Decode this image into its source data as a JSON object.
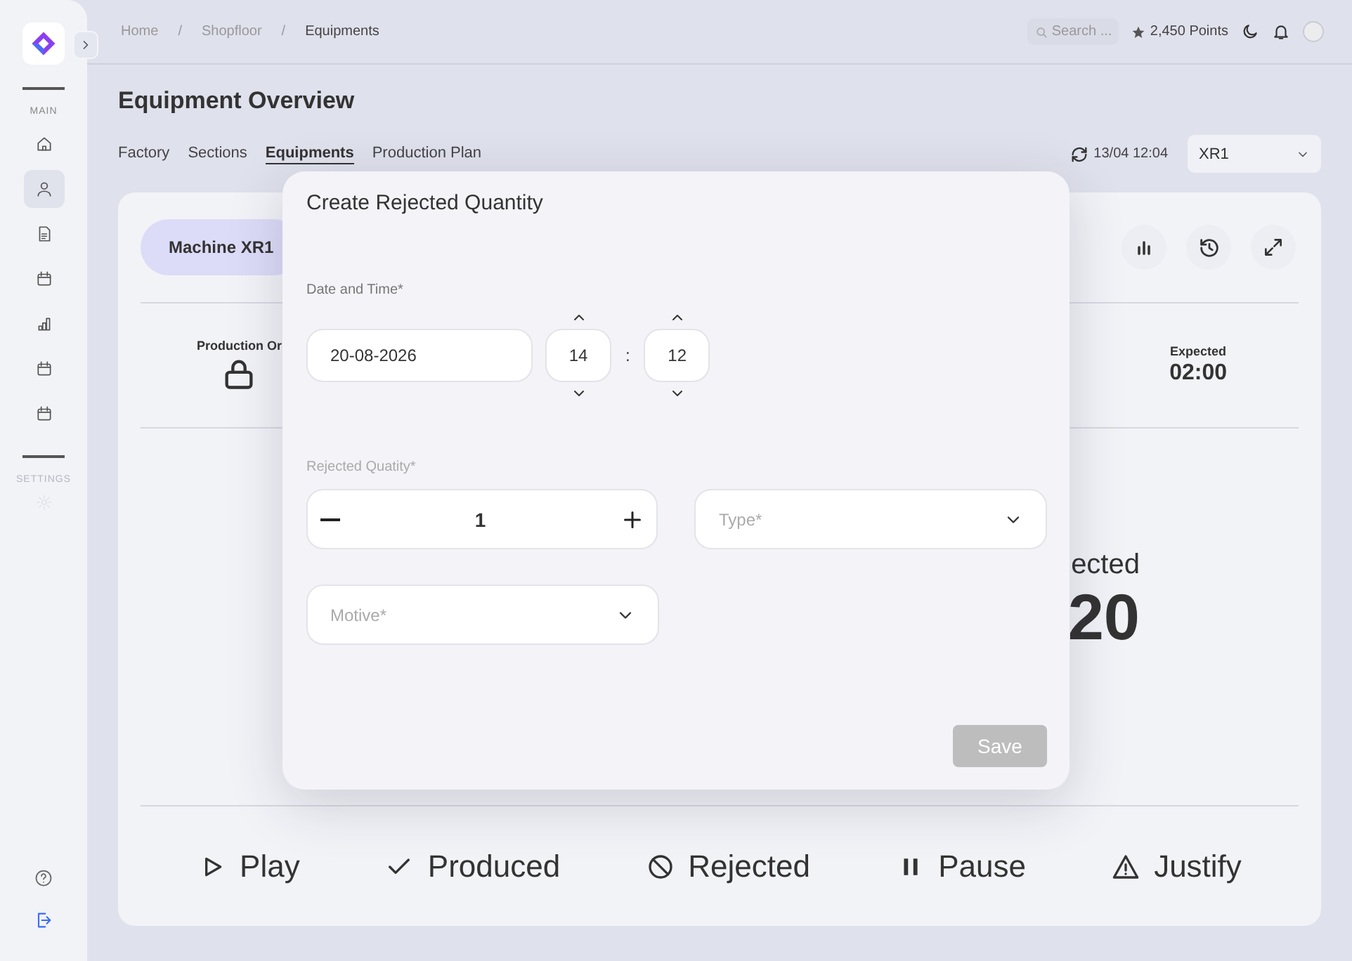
{
  "sidebar": {
    "section_main": "MAIN",
    "items": [
      {
        "selected": false
      },
      {
        "selected": true
      },
      {
        "selected": false
      },
      {
        "selected": false
      },
      {
        "selected": false
      },
      {
        "selected": false
      },
      {
        "selected": false
      }
    ],
    "section_settings": "SETTINGS"
  },
  "breadcrumbs": [
    {
      "kind": "link",
      "label": "Home"
    },
    {
      "kind": "separator",
      "label": "/"
    },
    {
      "kind": "link",
      "label": "Shopfloor"
    },
    {
      "kind": "separator",
      "label": "/"
    },
    {
      "kind": "current",
      "label": "Equipments"
    }
  ],
  "header": {
    "search": {
      "placeholder": "Search ..."
    },
    "points": "2,450 Points"
  },
  "page_title": "Equipment Overview",
  "tabs": [
    {
      "label": "Factory",
      "selected": false
    },
    {
      "label": "Sections",
      "selected": false
    },
    {
      "label": "Equipments",
      "selected": true
    },
    {
      "label": "Production Plan",
      "selected": false
    }
  ],
  "refresh": {
    "time": "13/04 12:04"
  },
  "equipment_select": {
    "value": "XR1"
  },
  "card": {
    "machine": "Machine XR1",
    "stats": [
      {
        "kind": "lock",
        "label": "Production Or"
      },
      {
        "kind": "value",
        "label": "Expected",
        "value": "02:00"
      }
    ],
    "highlight": {
      "label": "ected",
      "value": "20"
    },
    "actions": [
      {
        "kind": "play",
        "label": "Play"
      },
      {
        "kind": "check",
        "label": "Produced"
      },
      {
        "kind": "ban",
        "label": "Rejected"
      },
      {
        "kind": "pause",
        "label": "Pause"
      },
      {
        "kind": "warning",
        "label": "Justify"
      }
    ]
  },
  "modal": {
    "title": "Create Rejected Quantity",
    "date_label": "Date and Time*",
    "date": "20-08-2026",
    "hour": "14",
    "time_separator": ":",
    "minute": "12",
    "quantity_label": "Rejected Quatity*",
    "quantity": "1",
    "type": {
      "placeholder": "Type*"
    },
    "motive": {
      "placeholder": "Motive*"
    },
    "save": {
      "label": "Save",
      "disabled": true
    }
  }
}
